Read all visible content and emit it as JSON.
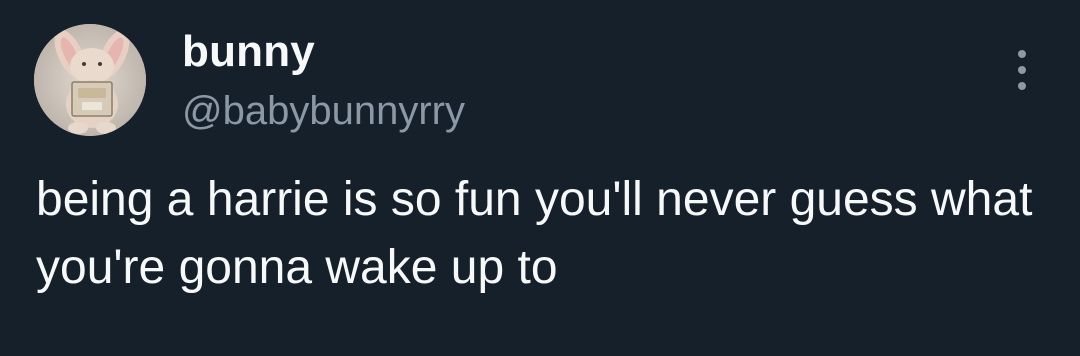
{
  "tweet": {
    "author": {
      "display_name": "bunny",
      "handle": "@babybunnyrry",
      "avatar_icon": "plush-bunny-avatar"
    },
    "more_icon": "more-options-icon",
    "text": "being a harrie is so fun you'll never guess what you're gonna wake up to"
  },
  "colors": {
    "background": "#15202b",
    "primary_text": "#f7f9f9",
    "secondary_text": "#8b98a5"
  }
}
